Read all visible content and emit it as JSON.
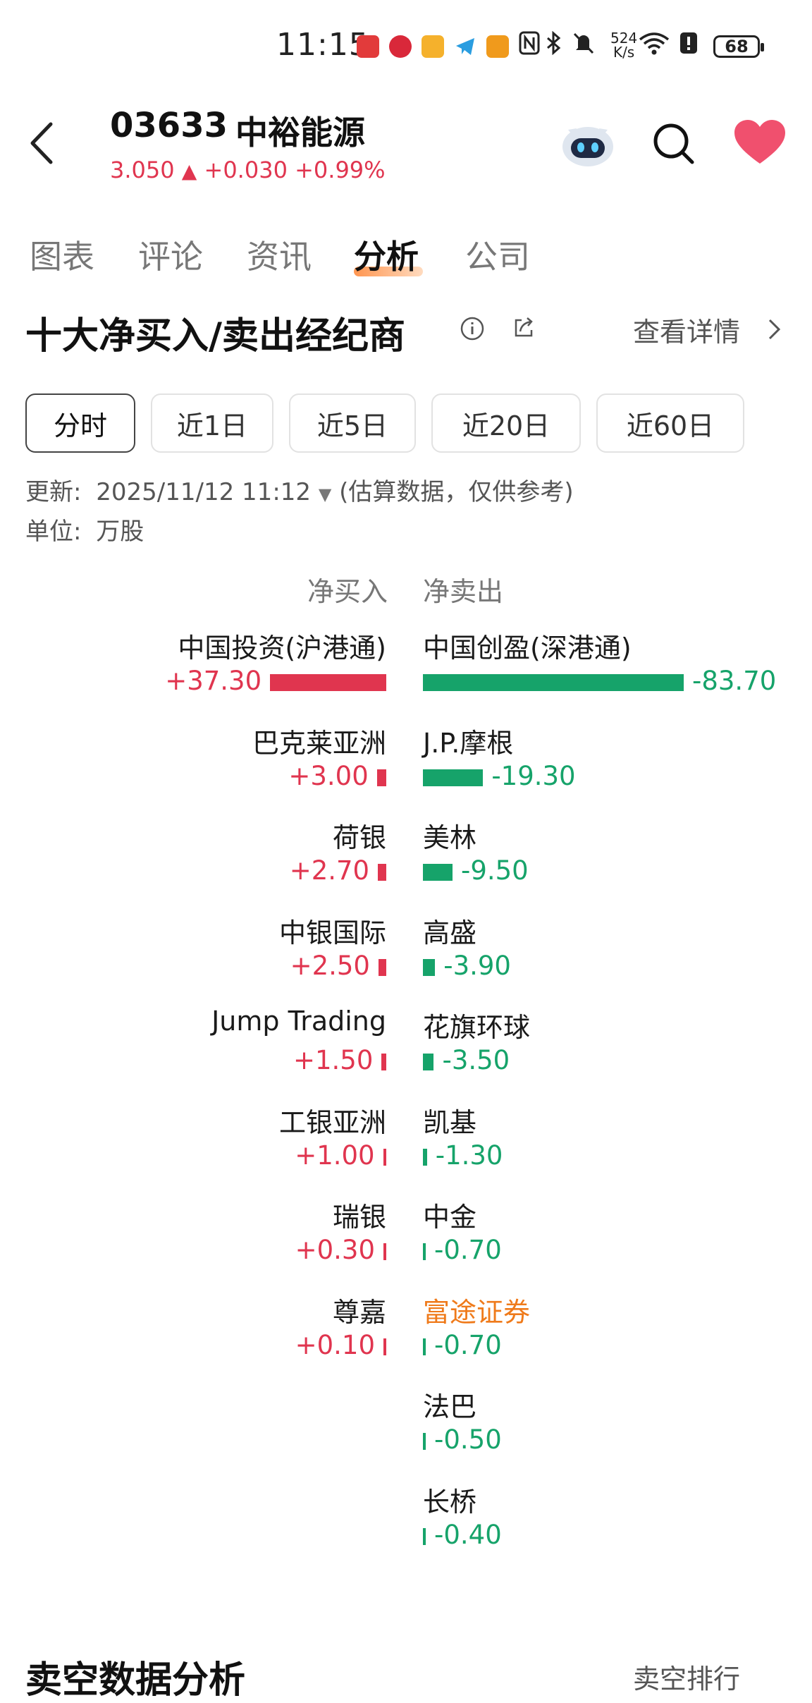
{
  "status_bar": {
    "time": "11:15",
    "net_speed_value": "524",
    "net_speed_unit": "K/s",
    "battery": "68",
    "icons": [
      "app-icon-red",
      "app-icon-red-round",
      "mail-icon",
      "telegram-icon",
      "app-icon-orange",
      "nfc-icon",
      "bluetooth-icon",
      "mute-icon",
      "wifi-icon",
      "alert-icon",
      "battery-icon"
    ]
  },
  "header": {
    "code": "03633",
    "name": "中裕能源",
    "price": "3.050",
    "change": "+0.030",
    "change_pct": "+0.99%",
    "colors": {
      "up": "#e0354f",
      "heart": "#f0506e"
    }
  },
  "tabs": [
    {
      "label": "图表",
      "active": false
    },
    {
      "label": "评论",
      "active": false
    },
    {
      "label": "资讯",
      "active": false
    },
    {
      "label": "分析",
      "active": true
    },
    {
      "label": "公司",
      "active": false
    }
  ],
  "section": {
    "title": "十大净买入/卖出经纪商",
    "detail_link": "查看详情"
  },
  "filters": [
    {
      "label": "分时",
      "active": true
    },
    {
      "label": "近1日",
      "active": false
    },
    {
      "label": "近5日",
      "active": false
    },
    {
      "label": "近20日",
      "active": false
    },
    {
      "label": "近60日",
      "active": false
    }
  ],
  "meta": {
    "update_label": "更新:",
    "update_time": "2025/11/12 11:12",
    "note": "(估算数据，仅供参考)",
    "unit_label": "单位:",
    "unit_value": "万股"
  },
  "chart_data": {
    "type": "bar",
    "left_header": "净买入",
    "right_header": "净卖出",
    "colors": {
      "buy": "#e0354f",
      "sell": "#16a36a",
      "highlight": "#ef7a1a"
    },
    "buy": [
      {
        "name": "中国投资(沪港通)",
        "value": 37.3,
        "label": "+37.30"
      },
      {
        "name": "巴克莱亚洲",
        "value": 3.0,
        "label": "+3.00"
      },
      {
        "name": "荷银",
        "value": 2.7,
        "label": "+2.70"
      },
      {
        "name": "中银国际",
        "value": 2.5,
        "label": "+2.50"
      },
      {
        "name": "Jump Trading",
        "value": 1.5,
        "label": "+1.50"
      },
      {
        "name": "工银亚洲",
        "value": 1.0,
        "label": "+1.00"
      },
      {
        "name": "瑞银",
        "value": 0.3,
        "label": "+0.30"
      },
      {
        "name": "尊嘉",
        "value": 0.1,
        "label": "+0.10"
      }
    ],
    "sell": [
      {
        "name": "中国创盈(深港通)",
        "value": -83.7,
        "label": "-83.70"
      },
      {
        "name": "J.P.摩根",
        "value": -19.3,
        "label": "-19.30"
      },
      {
        "name": "美林",
        "value": -9.5,
        "label": "-9.50"
      },
      {
        "name": "高盛",
        "value": -3.9,
        "label": "-3.90"
      },
      {
        "name": "花旗环球",
        "value": -3.5,
        "label": "-3.50"
      },
      {
        "name": "凯基",
        "value": -1.3,
        "label": "-1.30"
      },
      {
        "name": "中金",
        "value": -0.7,
        "label": "-0.70"
      },
      {
        "name": "富途证券",
        "value": -0.7,
        "label": "-0.70",
        "highlight": true
      },
      {
        "name": "法巴",
        "value": -0.5,
        "label": "-0.50"
      },
      {
        "name": "长桥",
        "value": -0.4,
        "label": "-0.40"
      }
    ]
  },
  "next_section": {
    "title": "卖空数据分析",
    "link": "卖空排行"
  }
}
